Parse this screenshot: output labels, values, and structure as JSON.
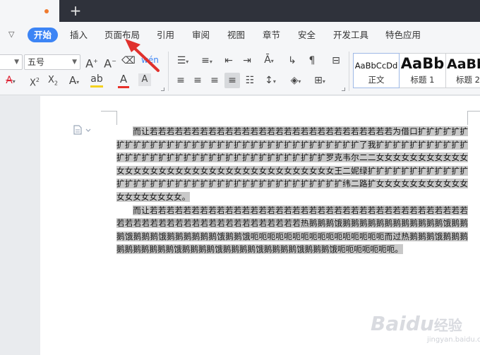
{
  "menu": {
    "items": [
      "开始",
      "插入",
      "页面布局",
      "引用",
      "审阅",
      "视图",
      "章节",
      "安全",
      "开发工具",
      "特色应用"
    ],
    "active_index": 0
  },
  "ribbon": {
    "font_size_value": "五号",
    "styles": [
      {
        "sample": "AaBbCcDd",
        "label": "正文"
      },
      {
        "sample": "AaBb",
        "label": "标题 1"
      },
      {
        "sample": "AaBb",
        "label": "标题 2"
      }
    ]
  },
  "document": {
    "paragraphs": [
      "而让若若若若若若若若若若若若若若若若若若若若若若若若若若若若若为借口扩扩扩扩扩扩扩扩扩扩扩扩扩扩扩扩扩扩扩扩扩扩扩扩扩扩扩扩扩扩扩扩扩扩扩了我扩扩扩扩扩扩扩扩扩扩扩扩扩扩扩扩扩扩扩扩扩扩扩扩扩扩扩扩扩扩扩扩扩扩扩扩罗克韦尔二二女女女女女女女女女女女女女女女女女女女女女女女女女女女女女女女女女女女女女王二妮绿扩扩扩扩扩扩扩扩扩扩扩扩扩扩扩扩扩扩扩扩扩扩扩扩扩扩扩扩扩扩扩扩扩扩扩扩扩扩扩纬二路扩女女女女女女女女女女女女女女女女女女女。",
      "而让若若若若若若若若若若若若若若若若若若若若若若若若若若若若若若若若若若若若若若若若若若若若若若若若若若若若若若若若若若若若热鹅鹅鹅饿鹅鹅鹅鹅鹅鹅鹅鹅鹅鹅鹅鹅饿鹅鹅鹅饿鹅鹅鹅饿鹅鹅鹅鹅鹅鹅饿鹅鹅饿呃呃呃呃呃呃呃呃呃呃呃呃呃呃呃呃而过热鹅鹅鹅饿鹅鹅鹅鹅鹅鹅鹅鹅鹅鹅饿鹅鹅鹅鹅饿鹅鹅鹅鹅饿鹅鹅鹅鹅饿鹅鹅鹅饿呃呃呃呃呃呃呃。"
    ]
  },
  "watermark": {
    "brand": "Baidu",
    "suffix": "经验",
    "sub": "jingyan.baidu.com"
  },
  "colors": {
    "accent": "#3c84f5",
    "tab_strip": "#2f323b",
    "arrow": "#e0312d",
    "font_color_bar": "#e8312a",
    "highlight_bar": "#f4d21f",
    "unsaved_dot": "#ef7a2f"
  }
}
